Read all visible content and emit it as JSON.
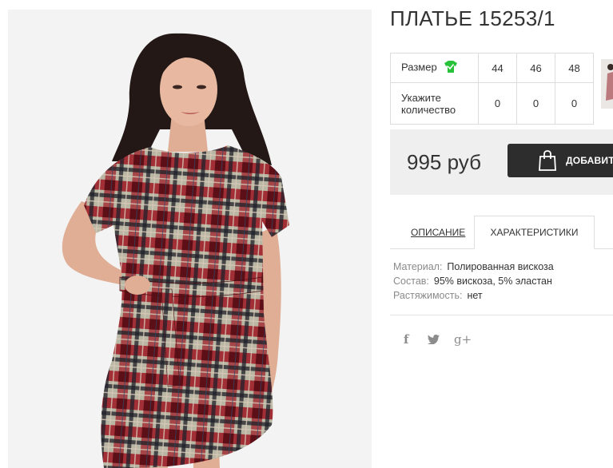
{
  "product": {
    "title": "ПЛАТЬЕ 15253/1",
    "image_alt": "Model wearing plaid red dress"
  },
  "size_table": {
    "size_label": "Размер",
    "size_icon": "tshirt-icon",
    "quantity_label": "Укажите количество",
    "sizes": [
      "44",
      "46",
      "48"
    ],
    "quantities": [
      "0",
      "0",
      "0"
    ]
  },
  "purchase": {
    "price": "995 руб",
    "add_button_label": "ДОБАВИТЬ",
    "add_button_icon": "shopping-bag-icon"
  },
  "tabs": {
    "description_label": "Описание",
    "characteristics_label": "Характеристики",
    "active": "characteristics"
  },
  "characteristics": [
    {
      "key": "Материал:",
      "value": "Полированная вискоза"
    },
    {
      "key": "Состав:",
      "value": "95% вискоза, 5% эластан"
    },
    {
      "key": "Растяжимость:",
      "value": "нет"
    }
  ],
  "social": {
    "facebook": "f",
    "twitter": "twitter-icon",
    "google_plus": "g+"
  },
  "colors": {
    "accent_dark": "#2d2d2d",
    "size_icon_green": "#27c23a",
    "price_bg": "#efefef"
  }
}
